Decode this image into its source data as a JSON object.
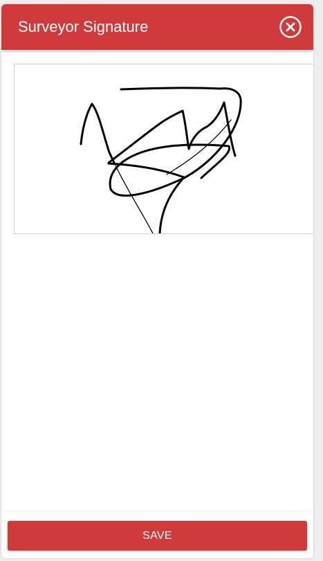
{
  "modal": {
    "title": "Surveyor Signature",
    "close_icon": "close-circle-icon",
    "save_label": "SAVE"
  },
  "colors": {
    "accent": "#cf3b3b",
    "header_text": "#ffffff",
    "ink": "#000000",
    "canvas_border": "#cfcfcf"
  }
}
